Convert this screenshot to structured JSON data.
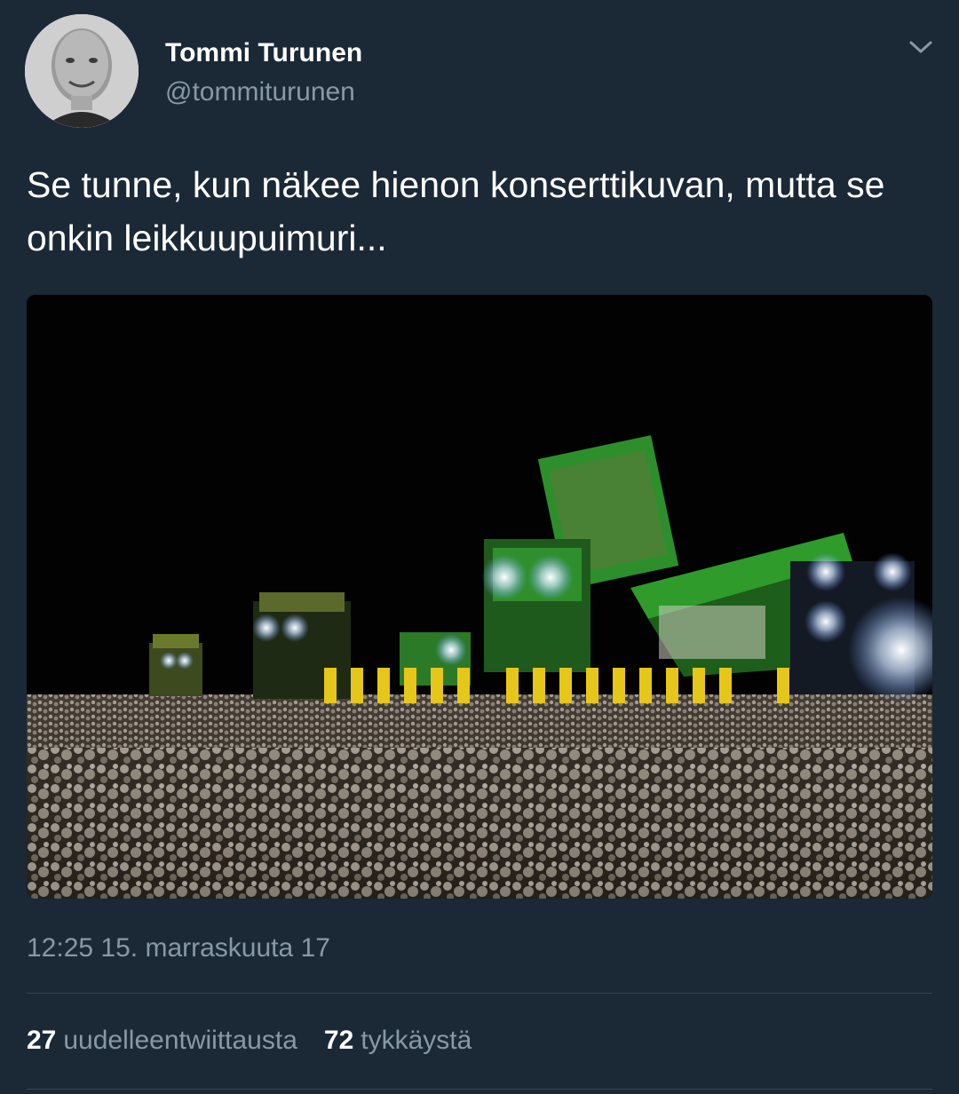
{
  "author": {
    "display_name": "Tommi Turunen",
    "handle": "@tommiturunen"
  },
  "tweet": {
    "text": "Se tunne, kun näkee hienon konserttikuvan, mutta se onkin leikkuupuimuri...",
    "timestamp": "12:25 15. marraskuuta 17"
  },
  "stats": {
    "retweets_count": "27",
    "retweets_label": "uudelleentwiittausta",
    "likes_count": "72",
    "likes_label": "tykkäystä"
  },
  "icons": {
    "menu": "chevron-down-icon"
  },
  "colors": {
    "background": "#1b2836",
    "secondary_text": "#8899a6",
    "divider": "#38444d",
    "harvester_green": "#2e9b2a",
    "harvester_yellow": "#e6c619"
  }
}
